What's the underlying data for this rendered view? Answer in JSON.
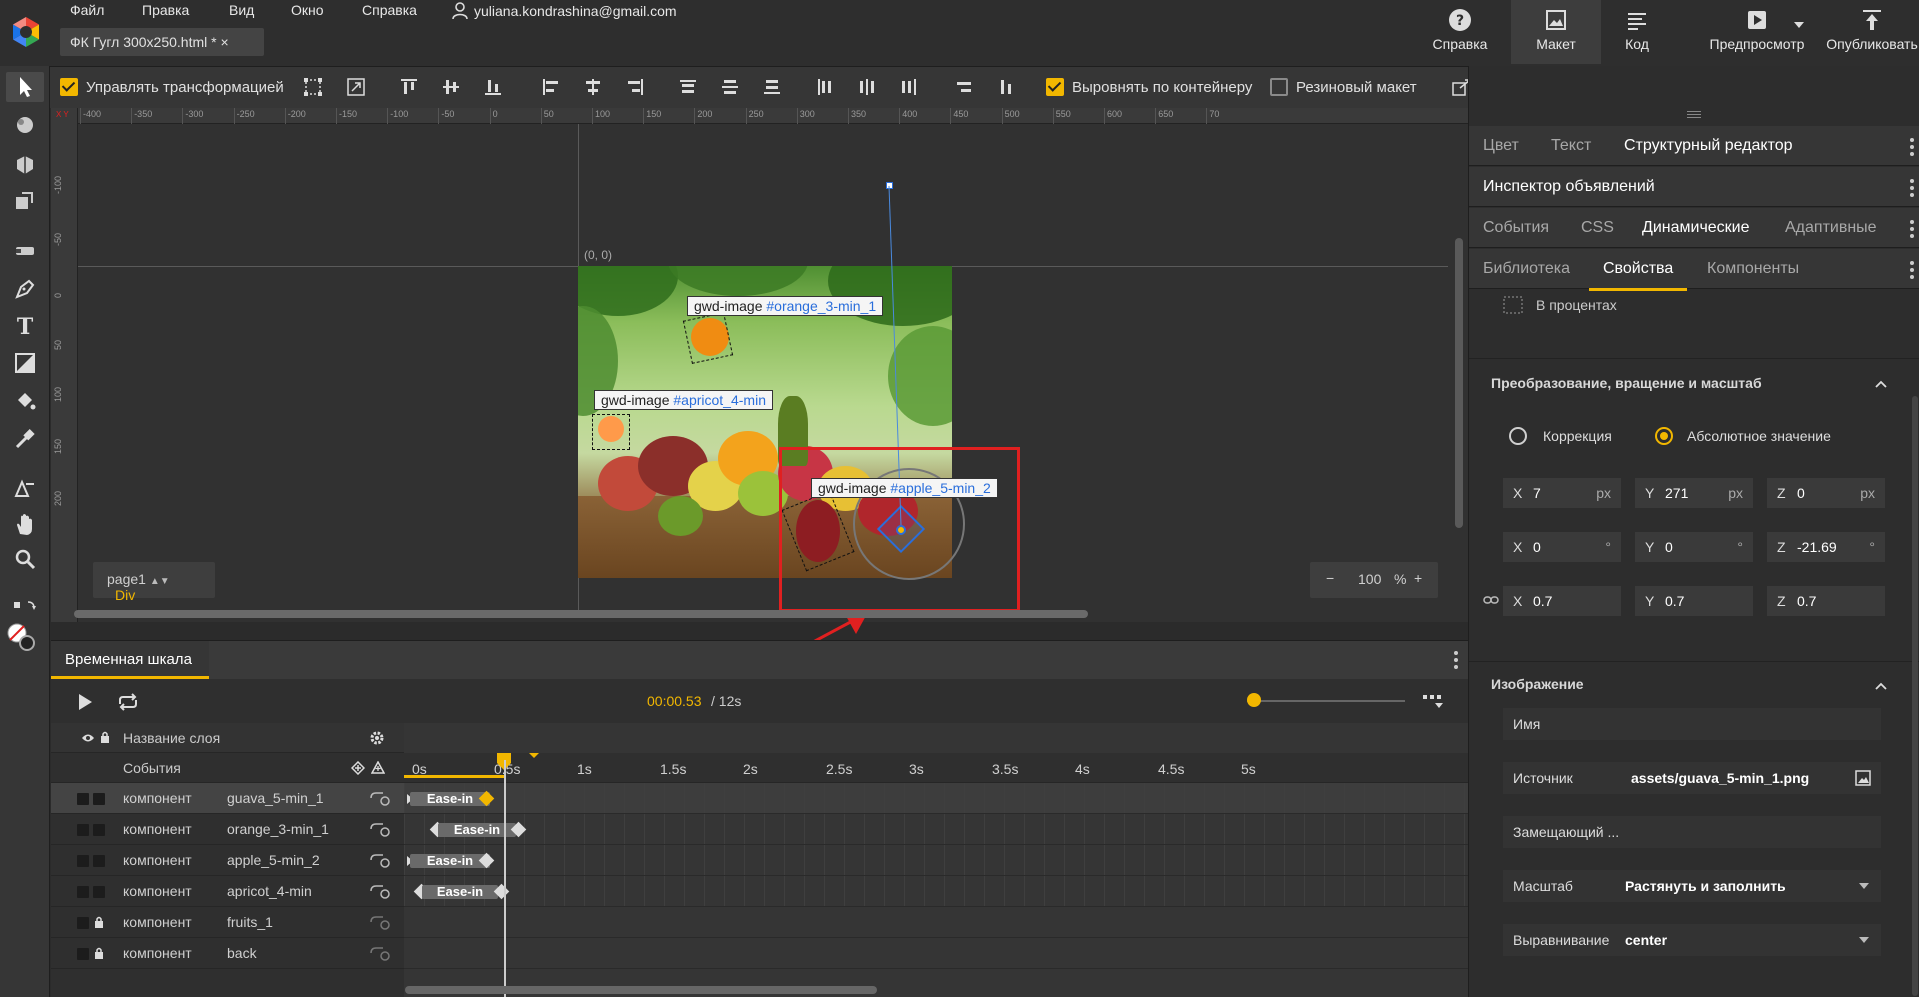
{
  "menu": {
    "items": [
      "Файл",
      "Правка",
      "Вид",
      "Окно",
      "Справка"
    ],
    "account": "yuliana.kondrashina@gmail.com",
    "doc_tab": "ФК Гугл 300x250.html *"
  },
  "right_buttons": {
    "help": "Справка",
    "layout": "Макет",
    "code": "Код",
    "preview": "Предпросмотр",
    "publish": "Опубликовать"
  },
  "toolbar": {
    "transform_label": "Управлять трансформацией",
    "align_container_label": "Выровнять по контейнеру",
    "rubber_layout_label": "Резиновый макет"
  },
  "ruler": {
    "h_labels": [
      "-400",
      "-350",
      "-300",
      "-250",
      "-200",
      "-150",
      "-100",
      "-50",
      "0",
      "50",
      "100",
      "150",
      "200",
      "250",
      "300",
      "350",
      "400",
      "450",
      "500",
      "550",
      "600",
      "650",
      "70"
    ],
    "v_labels": [
      "-100",
      "-50",
      "0",
      "50",
      "100",
      "150",
      "200"
    ]
  },
  "stage": {
    "origin_label": "(0, 0)",
    "labels": {
      "orange": {
        "tag": "gwd-image",
        "id": "#orange_3-min_1"
      },
      "apricot": {
        "tag": "gwd-image",
        "id": "#apricot_4-min"
      },
      "apple": {
        "tag": "gwd-image",
        "id": "#apple_5-min_2"
      }
    },
    "page": "page1",
    "page_type": "Div",
    "zoom": "100",
    "zoom_unit": "%",
    "zoom_minus": "−",
    "zoom_plus": "+"
  },
  "timeline": {
    "title": "Временная шкала",
    "current_time": "00:00.53",
    "total_time": "/ 12s",
    "layer_name_header": "Название слоя",
    "events_label": "События",
    "time_labels": [
      "0s",
      "0.5s",
      "1s",
      "1.5s",
      "2s",
      "2.5s",
      "3s",
      "3.5s",
      "4s",
      "4.5s",
      "5s"
    ],
    "layers": [
      {
        "type": "компонент",
        "name": "guava_5-min_1",
        "easing": "Ease-in",
        "locked": false
      },
      {
        "type": "компонент",
        "name": "orange_3-min_1",
        "easing": "Ease-in",
        "locked": false
      },
      {
        "type": "компонент",
        "name": "apple_5-min_2",
        "easing": "Ease-in",
        "locked": false
      },
      {
        "type": "компонент",
        "name": "apricot_4-min",
        "easing": "Ease-in",
        "locked": false
      },
      {
        "type": "компонент",
        "name": "fruits_1",
        "easing": "",
        "locked": true
      },
      {
        "type": "компонент",
        "name": "back",
        "easing": "",
        "locked": true
      }
    ]
  },
  "panel": {
    "top_tabs": [
      "Цвет",
      "Текст",
      "Структурный редактор"
    ],
    "ad_inspector": "Инспектор объявлений",
    "mid_tabs": [
      "События",
      "CSS",
      "Динамические",
      "Адаптивные"
    ],
    "lib_tabs": [
      "Библиотека",
      "Свойства",
      "Компоненты"
    ],
    "percent_label": "В процентах",
    "transform_section": "Преобразование, вращение и масштаб",
    "radio_correction": "Коррекция",
    "radio_absolute": "Абсолютное значение",
    "position": {
      "x": "7",
      "y": "271",
      "z": "0",
      "unit": "px"
    },
    "rotation": {
      "x": "0",
      "y": "0",
      "z": "-21.69",
      "unit": "°"
    },
    "scale": {
      "x": "0.7",
      "y": "0.7",
      "z": "0.7"
    },
    "axis_labels": {
      "x": "X",
      "y": "Y",
      "z": "Z"
    },
    "image_section": "Изображение",
    "image_props": {
      "name_label": "Имя",
      "source_label": "Источник",
      "source_value": "assets/guava_5-min_1.png",
      "placeholder_label": "Замещающий ...",
      "scale_label": "Масштаб",
      "scale_value": "Растянуть и заполнить",
      "align_label": "Выравнивание",
      "align_value": "center"
    }
  },
  "colors": {
    "accent": "#f2b700",
    "highlight_red": "#e02020",
    "id_blue": "#2a6edb"
  }
}
